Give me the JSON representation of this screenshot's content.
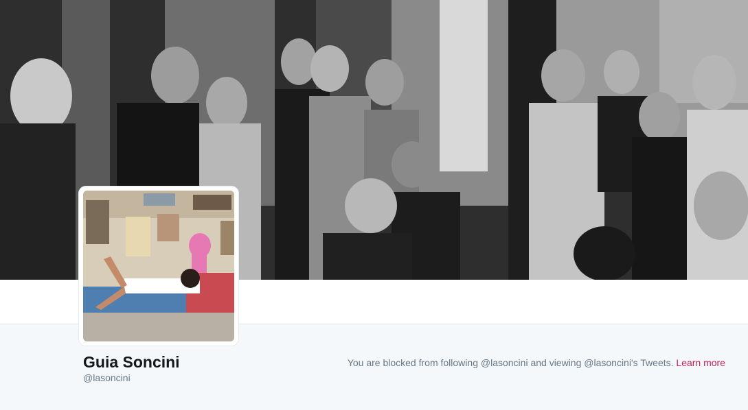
{
  "profile": {
    "name": "Guia Soncini",
    "handle": "@lasoncini"
  },
  "blocked_notice": {
    "text": "You are blocked from following @lasoncini and viewing @lasoncini's Tweets.",
    "link_label": "Learn more"
  },
  "colors": {
    "link": "#c51f5d",
    "page_background": "#f5f8fa",
    "muted_text": "#657786",
    "name_text": "#14171a"
  },
  "images": {
    "header": "black-and-white group photo of people at a party",
    "avatar": "colour photo of a girl lying on a bed under posters and a pink panther toy"
  }
}
